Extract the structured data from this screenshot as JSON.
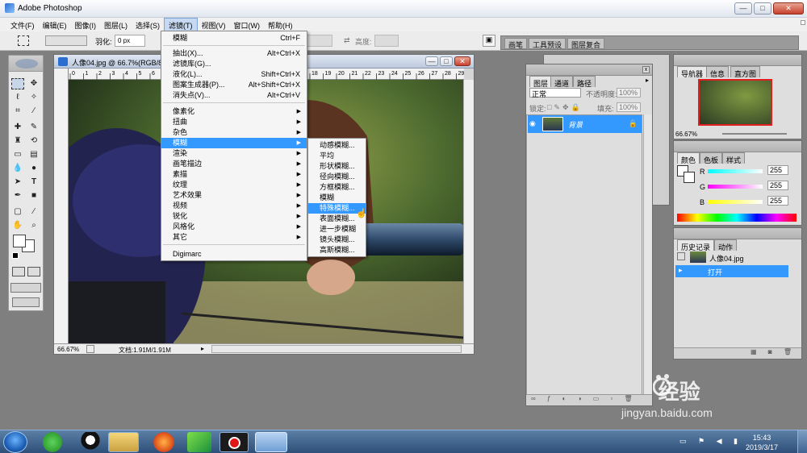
{
  "app": {
    "title": "Adobe Photoshop"
  },
  "menubar": [
    "文件(F)",
    "编辑(E)",
    "图像(I)",
    "图层(L)",
    "选择(S)",
    "滤镜(T)",
    "视图(V)",
    "窗口(W)",
    "帮助(H)"
  ],
  "options": {
    "feather_label": "羽化:",
    "feather_value": "0 px",
    "height_label": "高度:"
  },
  "well_tabs": [
    "画笔",
    "工具预设",
    "图层复合"
  ],
  "document": {
    "title": "人像04.jpg @ 66.7%(RGB/8)",
    "zoom": "66.67%",
    "doc_info": "文档:1.91M/1.91M",
    "ruler_ticks": [
      "0",
      "1",
      "2",
      "3",
      "4",
      "5",
      "6",
      "7",
      "8",
      "9",
      "10",
      "11",
      "12",
      "13",
      "14",
      "15",
      "16",
      "17",
      "18",
      "19",
      "20",
      "21",
      "22",
      "23",
      "24",
      "25",
      "26",
      "27",
      "28",
      "29"
    ]
  },
  "filter_menu": {
    "items": [
      {
        "label": "模糊",
        "shortcut": "Ctrl+F"
      },
      {
        "label": "抽出(X)...",
        "shortcut": "Alt+Ctrl+X"
      },
      {
        "label": "滤镜库(G)...",
        "shortcut": ""
      },
      {
        "label": "液化(L)...",
        "shortcut": "Shift+Ctrl+X"
      },
      {
        "label": "图案生成器(P)...",
        "shortcut": "Alt+Shift+Ctrl+X"
      },
      {
        "label": "消失点(V)...",
        "shortcut": "Alt+Ctrl+V"
      },
      {
        "label": "像素化",
        "shortcut": ""
      },
      {
        "label": "扭曲",
        "shortcut": ""
      },
      {
        "label": "杂色",
        "shortcut": ""
      },
      {
        "label": "模糊",
        "shortcut": ""
      },
      {
        "label": "渲染",
        "shortcut": ""
      },
      {
        "label": "画笔描边",
        "shortcut": ""
      },
      {
        "label": "素描",
        "shortcut": ""
      },
      {
        "label": "纹理",
        "shortcut": ""
      },
      {
        "label": "艺术效果",
        "shortcut": ""
      },
      {
        "label": "视频",
        "shortcut": ""
      },
      {
        "label": "锐化",
        "shortcut": ""
      },
      {
        "label": "风格化",
        "shortcut": ""
      },
      {
        "label": "其它",
        "shortcut": ""
      },
      {
        "label": "Digimarc",
        "shortcut": ""
      }
    ]
  },
  "blur_submenu": {
    "items": [
      "动感模糊...",
      "平均",
      "形状模糊...",
      "径向模糊...",
      "方框模糊...",
      "模糊",
      "特殊模糊...",
      "表面模糊...",
      "进一步模糊",
      "镜头模糊...",
      "高斯模糊..."
    ],
    "highlighted": "特殊模糊..."
  },
  "layers_panel": {
    "tabs": [
      "图层",
      "通道",
      "路径"
    ],
    "blend_mode": "正常",
    "opacity_label": "不透明度:",
    "opacity_value": "100%",
    "lock_label": "锁定:",
    "fill_label": "填充:",
    "fill_value": "100%",
    "layer_name": "背景"
  },
  "navigator_panel": {
    "tabs": [
      "导航器",
      "信息",
      "直方图"
    ],
    "zoom": "66.67%"
  },
  "color_panel": {
    "tabs": [
      "颜色",
      "色板",
      "样式"
    ],
    "channels": [
      {
        "name": "R",
        "value": "255"
      },
      {
        "name": "G",
        "value": "255"
      },
      {
        "name": "B",
        "value": "255"
      }
    ]
  },
  "history_panel": {
    "tabs": [
      "历史记录",
      "动作"
    ],
    "snapshot": "人像04.jpg",
    "state": "打开"
  },
  "watermark": {
    "brand": "Bai 经验",
    "url": "jingyan.baidu.com"
  },
  "taskbar": {
    "time": "15:43",
    "date": "2019/3/17"
  },
  "colors": {
    "menu_highlight": "#3399ff",
    "layer_selected": "#3399ff",
    "taskbar": "#2d4f79"
  }
}
